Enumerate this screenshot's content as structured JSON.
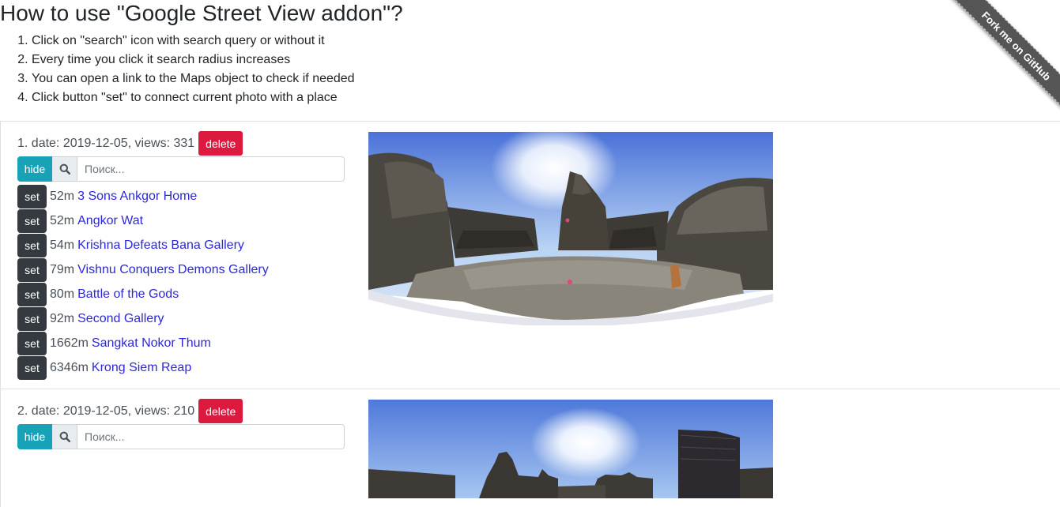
{
  "page": {
    "title": "How to use \"Google Street View addon\"?",
    "instructions": [
      "Click on \"search\" icon with search query or without it",
      "Every time you click it search radius increases",
      "You can open a link to the Maps object to check if needed",
      "Click button \"set\" to connect current photo with a place"
    ],
    "ribbon": "Fork me on GitHub"
  },
  "entries": [
    {
      "meta": "1. date: 2019-12-05, views: 331",
      "delete_label": "delete",
      "hide_label": "hide",
      "search_placeholder": "Поиск...",
      "set_label": "set",
      "places": [
        {
          "distance": "52m",
          "name": "3 Sons Ankgor Home"
        },
        {
          "distance": "52m",
          "name": "Angkor Wat"
        },
        {
          "distance": "54m",
          "name": "Krishna Defeats Bana Gallery"
        },
        {
          "distance": "79m",
          "name": "Vishnu Conquers Demons Gallery"
        },
        {
          "distance": "80m",
          "name": "Battle of the Gods"
        },
        {
          "distance": "92m",
          "name": "Second Gallery"
        },
        {
          "distance": "1662m",
          "name": "Sangkat Nokor Thum"
        },
        {
          "distance": "6346m",
          "name": "Krong Siem Reap"
        }
      ]
    },
    {
      "meta": "2. date: 2019-12-05, views: 210",
      "delete_label": "delete",
      "hide_label": "hide",
      "search_placeholder": "Поиск...",
      "places": []
    }
  ],
  "colors": {
    "delete": "#dc1a3f",
    "hide": "#17a2b8",
    "set": "#343a40",
    "link": "#2d28d6",
    "ribbon": "#555555"
  },
  "icons": {
    "search": "search-icon"
  }
}
